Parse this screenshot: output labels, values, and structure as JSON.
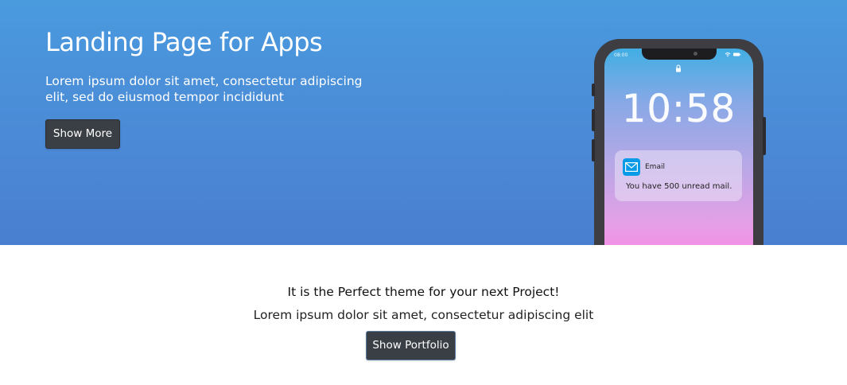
{
  "hero": {
    "title": "Landing Page for Apps",
    "subtitle": "Lorem ipsum dolor sit amet, consectetur adipiscing elit, sed do eiusmod tempor incididunt",
    "button_label": "Show More",
    "background_color": "#4a8ad6"
  },
  "phone": {
    "status_time": "08:00",
    "clock": "10:58",
    "notification": {
      "app_name": "Email",
      "message": "You have 500 unread mail.",
      "icon": "mail-icon"
    },
    "lock_icon": "lock-icon"
  },
  "section": {
    "title": "It is the Perfect theme for your next Project!",
    "subtitle": "Lorem ipsum dolor sit amet, consectetur adipiscing elit",
    "button_label": "Show Portfolio"
  },
  "colors": {
    "button_bg": "#3a3f46",
    "accent_blue": "#4a8ad6"
  }
}
